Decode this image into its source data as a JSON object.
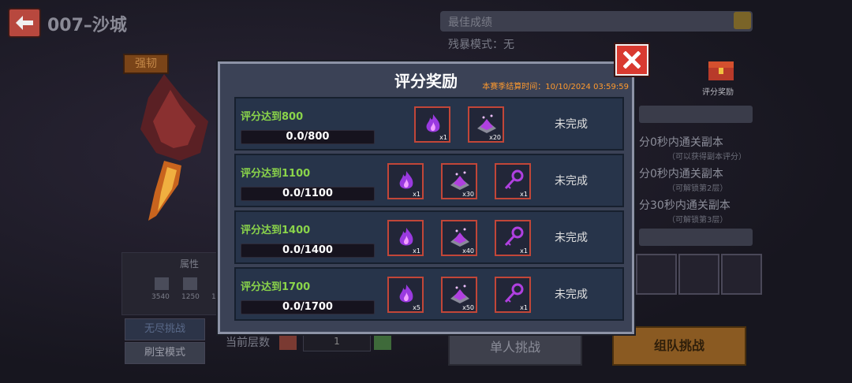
{
  "header": {
    "level_title": "007–沙城"
  },
  "hero": {
    "tough_badge": "强韧"
  },
  "best": {
    "label": "最佳成绩",
    "mode": "残暴模式：无"
  },
  "reward_entry": {
    "label": "评分奖励"
  },
  "tasks": [
    {
      "title": "分0秒内通关副本",
      "sub": "（可以获得副本评分）"
    },
    {
      "title": "分0秒内通关副本",
      "sub": "（可解锁第2层）"
    },
    {
      "title": "分30秒内通关副本",
      "sub": "（可解锁第3层）"
    }
  ],
  "attributes": {
    "title": "属性",
    "values": [
      "3540",
      "1250",
      "1"
    ]
  },
  "side_buttons": {
    "endless": "无尽挑战",
    "treasure": "刷宝模式"
  },
  "floor": {
    "label": "当前层数",
    "value": "1"
  },
  "buttons": {
    "solo": "单人挑战",
    "team": "组队挑战"
  },
  "modal": {
    "title": "评分奖励",
    "settle_time": "本赛季结算时间：10/10/2024 03:59:59",
    "rows": [
      {
        "label": "评分达到800",
        "progress": "0.0/800",
        "status": "未完成",
        "items": [
          {
            "icon": "purple-flame-icon",
            "qty": "x1"
          },
          {
            "icon": "purple-crystal-pile-icon",
            "qty": "x20"
          }
        ]
      },
      {
        "label": "评分达到1100",
        "progress": "0.0/1100",
        "status": "未完成",
        "items": [
          {
            "icon": "purple-flame-icon",
            "qty": "x1"
          },
          {
            "icon": "purple-crystal-pile-icon",
            "qty": "x30"
          },
          {
            "icon": "purple-key-icon",
            "qty": "x1"
          }
        ]
      },
      {
        "label": "评分达到1400",
        "progress": "0.0/1400",
        "status": "未完成",
        "items": [
          {
            "icon": "purple-flame-icon",
            "qty": "x1"
          },
          {
            "icon": "purple-crystal-pile-icon",
            "qty": "x40"
          },
          {
            "icon": "purple-key-icon",
            "qty": "x1"
          }
        ]
      },
      {
        "label": "评分达到1700",
        "progress": "0.0/1700",
        "status": "未完成",
        "items": [
          {
            "icon": "purple-flame-icon",
            "qty": "x5"
          },
          {
            "icon": "purple-crystal-pile-icon",
            "qty": "x50"
          },
          {
            "icon": "purple-key-icon",
            "qty": "x1"
          }
        ]
      }
    ]
  },
  "colors": {
    "accent_green": "#8ad44a",
    "settle_orange": "#ff9a2e",
    "item_border": "#c24638",
    "close_red": "#d93a30"
  }
}
